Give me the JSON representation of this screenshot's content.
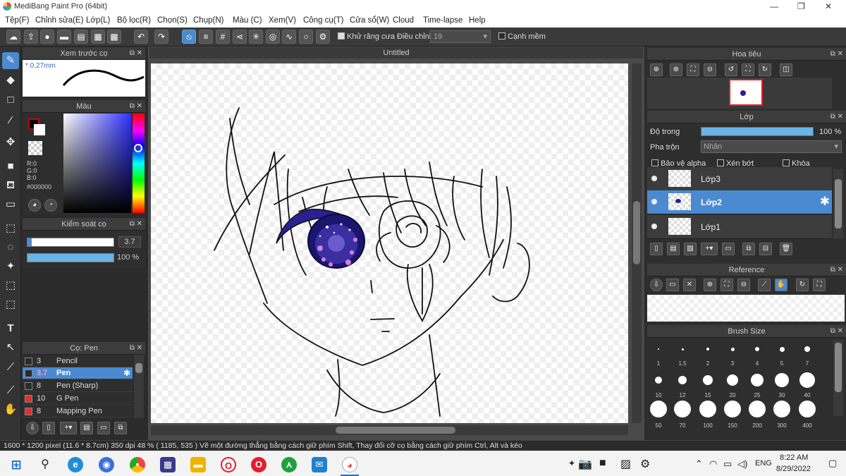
{
  "window": {
    "title": "MediBang Paint Pro (64bit)",
    "min": "—",
    "max": "❐",
    "close": "✕"
  },
  "menu": [
    "Tệp(F)",
    "Chỉnh sửa(E)",
    "Lớp(L)",
    "Bộ lọc(R)",
    "Chọn(S)",
    "Chụp(N)",
    "Màu (C)",
    "Xem(V)",
    "Công cụ(T)",
    "Cửa sổ(W)",
    "Cloud",
    "Time-lapse",
    "Help"
  ],
  "toolbar": {
    "antialias_label": "Khử răng cưa",
    "adjust_label": "Điều chỉnh",
    "adjust_value": "19",
    "soft_edge_label": "Cạnh mềm"
  },
  "brush_preview": {
    "title": "Xem trước cọ",
    "size": "* 0.27mm"
  },
  "color": {
    "title": "Màu",
    "r": "R:0",
    "g": "G:0",
    "b": "B:0",
    "hex": "#000000"
  },
  "brush_control": {
    "title": "Kiểm soát cọ",
    "size_value": "3.7",
    "opacity_value": "100 %"
  },
  "brush_list": {
    "title": "Cọ: Pen",
    "items": [
      {
        "size": "3",
        "name": "Pencil",
        "color": "#2a2a2a"
      },
      {
        "size": "3.7",
        "name": "Pen",
        "color": "#2a2a2a"
      },
      {
        "size": "8",
        "name": "Pen (Sharp)",
        "color": "#2a2a2a"
      },
      {
        "size": "10",
        "name": "G Pen",
        "color": "#e03030"
      },
      {
        "size": "8",
        "name": "Mapping Pen",
        "color": "#e03030"
      }
    ]
  },
  "document": {
    "tab_title": "Untitled"
  },
  "navigator": {
    "title": "Hoa tiêu"
  },
  "layers": {
    "title": "Lớp",
    "opacity_label": "Độ trong",
    "opacity_value": "100 %",
    "opacity_fraction": 1.0,
    "blend_label": "Pha trộn",
    "blend_value": "Nhân",
    "protect_alpha": "Bảo vệ alpha",
    "clipping": "Xén bớt",
    "lock": "Khóa",
    "items": [
      {
        "name": "Lớp3",
        "selected": false
      },
      {
        "name": "Lớp2",
        "selected": true
      },
      {
        "name": "Lớp1",
        "selected": false
      }
    ]
  },
  "reference": {
    "title": "Reference"
  },
  "brush_size": {
    "title": "Brush Size",
    "row1": [
      "1",
      "1.5",
      "2",
      "3",
      "4",
      "5",
      "7"
    ],
    "row2": [
      "10",
      "12",
      "15",
      "20",
      "25",
      "30",
      "40"
    ],
    "row3": [
      "50",
      "70",
      "100",
      "150",
      "200",
      "300",
      "400"
    ]
  },
  "status": {
    "text": "1600 * 1200 pixel  (11.6 * 8.7cm)  350 dpi  48 %  ( 1185, 535 )  Vẽ một đường thẳng bằng cách giữ phím Shift, Thay đổi cỡ cọ bằng cách giữ phím Ctrl, Alt và kéo"
  },
  "taskbar": {
    "lang": "ENG",
    "time": "8:22 AM",
    "date": "8/29/2022"
  },
  "colors": {
    "accent": "#4a8ad0",
    "panel": "#2e2e2e",
    "eye_purple": "#2a2090"
  }
}
